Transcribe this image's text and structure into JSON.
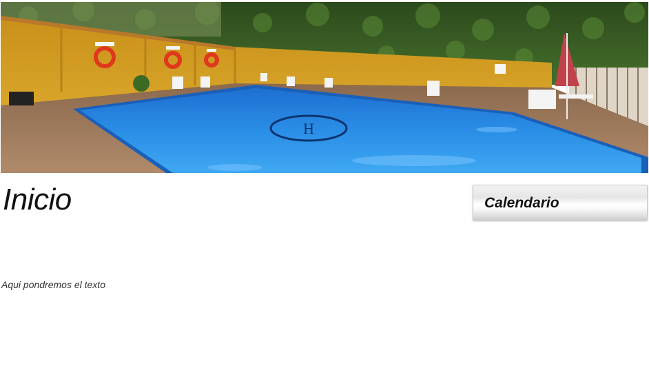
{
  "header": {
    "banner_image": "Outdoor swimming pool with orange walls, hedges, life rings and white plastic chairs"
  },
  "main": {
    "title": "Inicio",
    "body_text": "Aqui pondremos el texto"
  },
  "sidebar": {
    "calendar_title": "Calendario"
  },
  "colors": {
    "wall": "#d9a21f",
    "pool_water": "#2a8fe0",
    "hedge": "#3f6a2a",
    "text": "#111111"
  }
}
